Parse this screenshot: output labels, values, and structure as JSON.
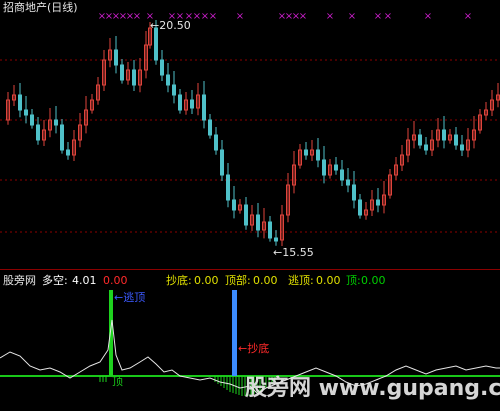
{
  "title": "招商地产(日线)",
  "price_panel": {
    "high_label": "20.50",
    "low_label": "15.55",
    "marker_glyph": "×",
    "marker_count": 24,
    "colors": {
      "up": "#e0443c",
      "down": "#4fc1c9",
      "marker": "#c81ec8",
      "grid": "#8b0000",
      "text": "#e6e6e6"
    }
  },
  "indicator_panel": {
    "name": "股旁网",
    "items": [
      {
        "label": "多空:",
        "value": "4.01",
        "value2": "0.00",
        "color": "#ffffff"
      },
      {
        "label": "抄底:",
        "value": "0.00",
        "color": "#e0e000"
      },
      {
        "label": "顶部:",
        "value": "0.00",
        "color": "#e0e000"
      },
      {
        "label": "逃顶:",
        "value": "0.00",
        "color": "#e0e000"
      },
      {
        "label": "顶:",
        "value": "0.00",
        "color": "#00d000"
      }
    ],
    "annotations": {
      "escape_top": "逃顶",
      "buy_bottom": "抄底",
      "top": "顶"
    },
    "colors": {
      "line": "#e6e6e6",
      "baseline": "#19c819",
      "green_bar": "#1ed21e",
      "blue_bar": "#3c8cff",
      "escape_text": "#3c5aff",
      "buy_text": "#ff2a2a"
    }
  },
  "watermark": "股旁网 www.gupang.com"
}
